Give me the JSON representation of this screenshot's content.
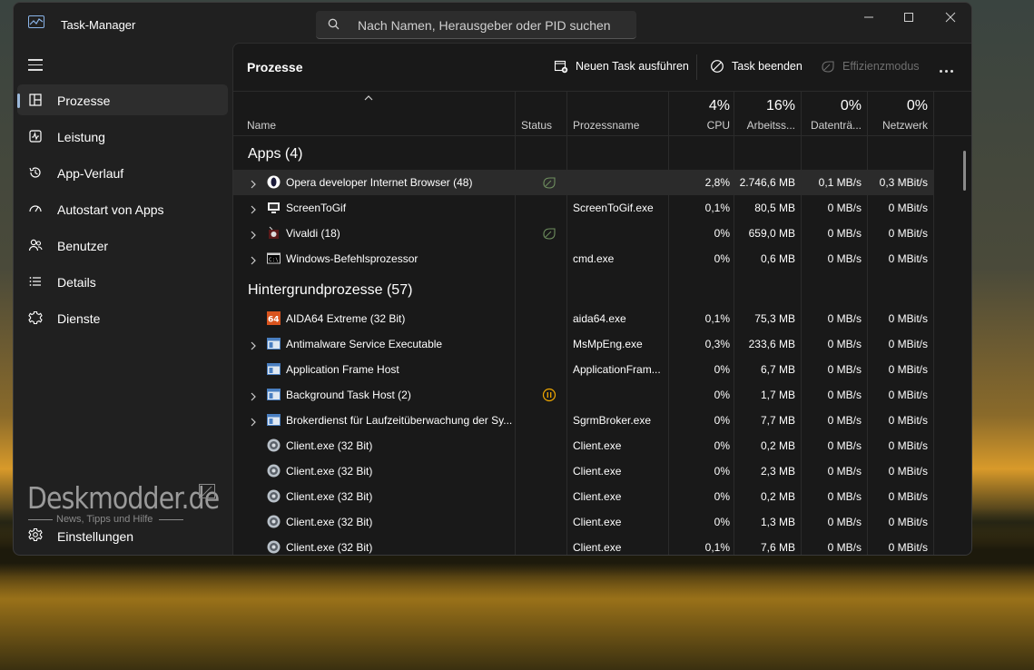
{
  "window": {
    "title": "Task-Manager"
  },
  "search": {
    "placeholder": "Nach Namen, Herausgeber oder PID suchen"
  },
  "sidebar": {
    "items": [
      {
        "label": "Prozesse",
        "icon": "processes-icon",
        "active": true
      },
      {
        "label": "Leistung",
        "icon": "performance-icon"
      },
      {
        "label": "App-Verlauf",
        "icon": "history-icon"
      },
      {
        "label": "Autostart von Apps",
        "icon": "startup-icon"
      },
      {
        "label": "Benutzer",
        "icon": "users-icon"
      },
      {
        "label": "Details",
        "icon": "details-icon"
      },
      {
        "label": "Dienste",
        "icon": "services-icon"
      }
    ],
    "settings_label": "Einstellungen"
  },
  "watermark": {
    "main": "Deskmodder.de",
    "sub": "News, Tipps und Hilfe"
  },
  "toolbar": {
    "title": "Prozesse",
    "new_task": "Neuen Task ausführen",
    "end_task": "Task beenden",
    "efficiency": "Effizienzmodus"
  },
  "columns": {
    "name": "Name",
    "status": "Status",
    "process": "Prozessname",
    "cpu_pct": "4%",
    "cpu": "CPU",
    "mem_pct": "16%",
    "mem": "Arbeitss...",
    "disk_pct": "0%",
    "disk": "Datenträ...",
    "net_pct": "0%",
    "net": "Netzwerk"
  },
  "groups": {
    "apps": "Apps (4)",
    "background": "Hintergrundprozesse (57)"
  },
  "apps": [
    {
      "name": "Opera developer Internet Browser (48)",
      "process": "",
      "cpu": "2,8%",
      "mem": "2.746,6 MB",
      "disk": "0,1 MB/s",
      "net": "0,3 MBit/s",
      "expand": true,
      "status": "efficiency",
      "icon": "opera-icon",
      "hl": true
    },
    {
      "name": "ScreenToGif",
      "process": "ScreenToGif.exe",
      "cpu": "0,1%",
      "mem": "80,5 MB",
      "disk": "0 MB/s",
      "net": "0 MBit/s",
      "expand": true,
      "status": "",
      "icon": "screentogif-icon"
    },
    {
      "name": "Vivaldi (18)",
      "process": "",
      "cpu": "0%",
      "mem": "659,0 MB",
      "disk": "0 MB/s",
      "net": "0 MBit/s",
      "expand": true,
      "status": "efficiency",
      "icon": "vivaldi-icon"
    },
    {
      "name": "Windows-Befehlsprozessor",
      "process": "cmd.exe",
      "cpu": "0%",
      "mem": "0,6 MB",
      "disk": "0 MB/s",
      "net": "0 MBit/s",
      "expand": true,
      "status": "",
      "icon": "cmd-icon"
    }
  ],
  "background": [
    {
      "name": "AIDA64 Extreme (32 Bit)",
      "process": "aida64.exe",
      "cpu": "0,1%",
      "mem": "75,3 MB",
      "disk": "0 MB/s",
      "net": "0 MBit/s",
      "expand": false,
      "status": "",
      "icon": "aida64-icon",
      "icon_text": "64"
    },
    {
      "name": "Antimalware Service Executable",
      "process": "MsMpEng.exe",
      "cpu": "0,3%",
      "mem": "233,6 MB",
      "disk": "0 MB/s",
      "net": "0 MBit/s",
      "expand": true,
      "status": "",
      "icon": "window-app-icon"
    },
    {
      "name": "Application Frame Host",
      "process": "ApplicationFram...",
      "cpu": "0%",
      "mem": "6,7 MB",
      "disk": "0 MB/s",
      "net": "0 MBit/s",
      "expand": false,
      "status": "",
      "icon": "window-app-icon"
    },
    {
      "name": "Background Task Host (2)",
      "process": "",
      "cpu": "0%",
      "mem": "1,7 MB",
      "disk": "0 MB/s",
      "net": "0 MBit/s",
      "expand": true,
      "status": "paused",
      "icon": "window-app-icon"
    },
    {
      "name": "Brokerdienst für Laufzeitüberwachung der Sy...",
      "process": "SgrmBroker.exe",
      "cpu": "0%",
      "mem": "7,7 MB",
      "disk": "0 MB/s",
      "net": "0 MBit/s",
      "expand": true,
      "status": "",
      "icon": "window-app-icon"
    },
    {
      "name": "Client.exe (32 Bit)",
      "process": "Client.exe",
      "cpu": "0%",
      "mem": "0,2 MB",
      "disk": "0 MB/s",
      "net": "0 MBit/s",
      "expand": false,
      "status": "",
      "icon": "client-icon"
    },
    {
      "name": "Client.exe (32 Bit)",
      "process": "Client.exe",
      "cpu": "0%",
      "mem": "2,3 MB",
      "disk": "0 MB/s",
      "net": "0 MBit/s",
      "expand": false,
      "status": "",
      "icon": "client-icon"
    },
    {
      "name": "Client.exe (32 Bit)",
      "process": "Client.exe",
      "cpu": "0%",
      "mem": "0,2 MB",
      "disk": "0 MB/s",
      "net": "0 MBit/s",
      "expand": false,
      "status": "",
      "icon": "client-icon"
    },
    {
      "name": "Client.exe (32 Bit)",
      "process": "Client.exe",
      "cpu": "0%",
      "mem": "1,3 MB",
      "disk": "0 MB/s",
      "net": "0 MBit/s",
      "expand": false,
      "status": "",
      "icon": "client-icon"
    },
    {
      "name": "Client.exe (32 Bit)",
      "process": "Client.exe",
      "cpu": "0,1%",
      "mem": "7,6 MB",
      "disk": "0 MB/s",
      "net": "0 MBit/s",
      "expand": false,
      "status": "",
      "icon": "client-icon"
    }
  ],
  "colors": {
    "accent": "#9bb8d9",
    "paused": "#f0a800",
    "efficiency": "#6f8f5f"
  }
}
